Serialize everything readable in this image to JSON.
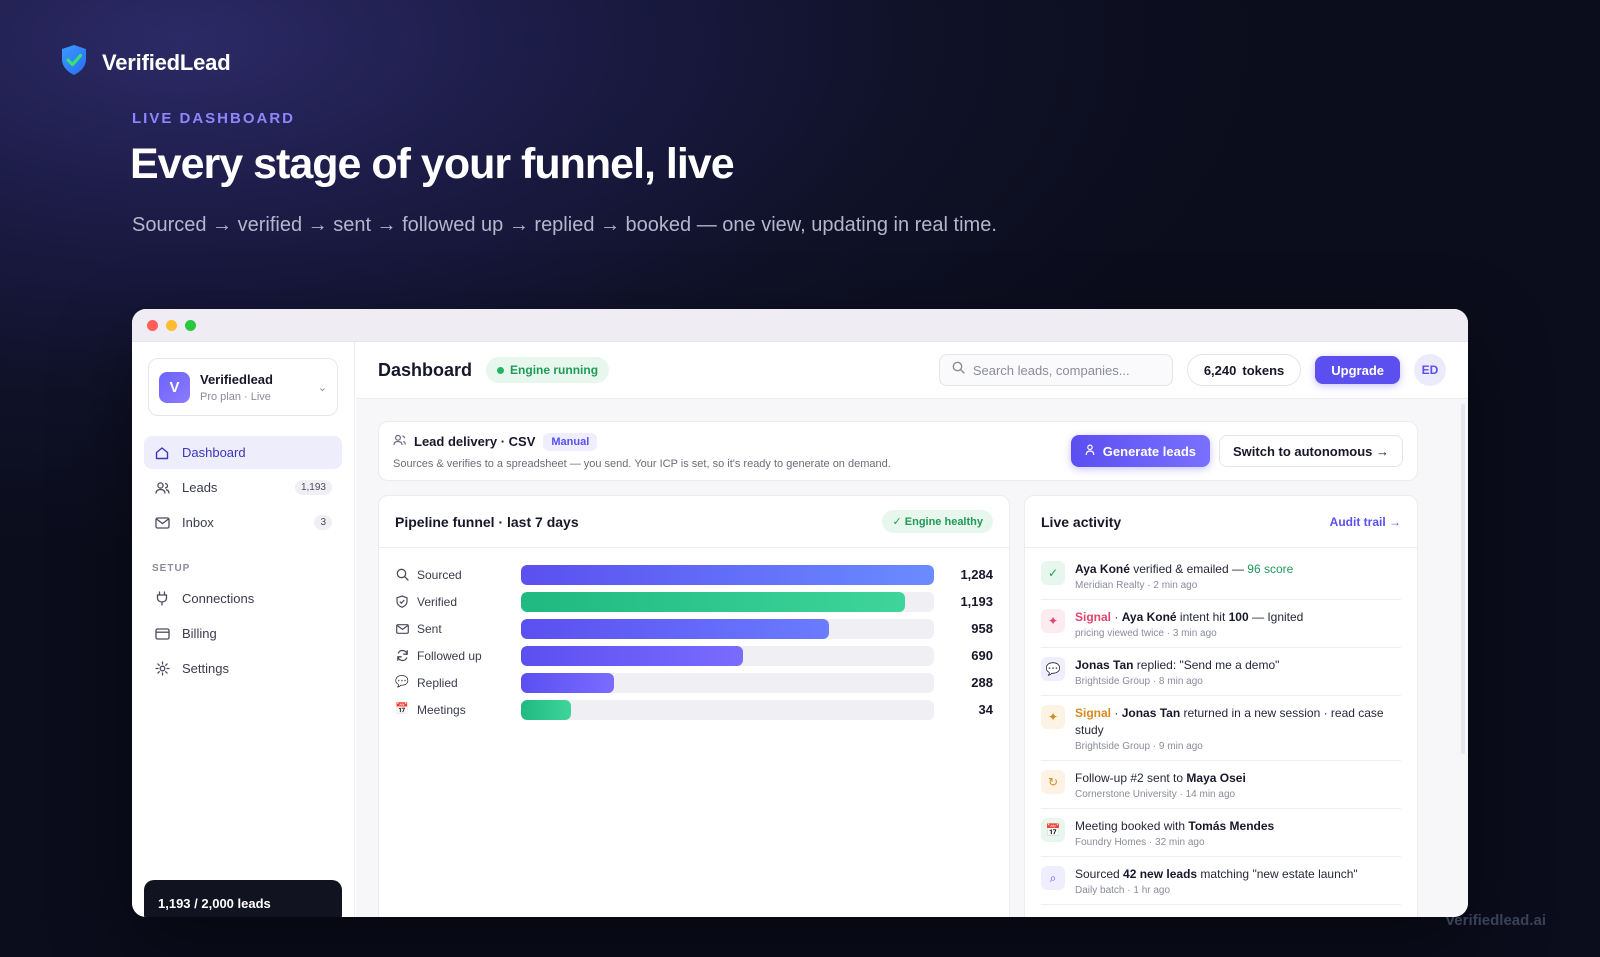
{
  "brand": {
    "name": "VerifiedLead"
  },
  "hero": {
    "eyebrow": "LIVE DASHBOARD",
    "headline": "Every stage of your funnel, live",
    "subline": "Sourced → verified → sent → followed up → replied → booked — one view, updating in real time."
  },
  "footer": {
    "url": "verifiedlead.ai"
  },
  "sidebar": {
    "workspace": {
      "initial": "V",
      "name": "Verifiedlead",
      "plan": "Pro plan · Live"
    },
    "items": [
      {
        "label": "Dashboard",
        "icon": "home-icon",
        "active": true
      },
      {
        "label": "Leads",
        "icon": "users-icon",
        "count": "1,193"
      },
      {
        "label": "Inbox",
        "icon": "mail-icon",
        "count": "3"
      }
    ],
    "setup_label": "SETUP",
    "setup_items": [
      {
        "label": "Connections",
        "icon": "plug-icon"
      },
      {
        "label": "Billing",
        "icon": "card-icon"
      },
      {
        "label": "Settings",
        "icon": "gear-icon"
      }
    ],
    "quota": "1,193 / 2,000 leads"
  },
  "topbar": {
    "title": "Dashboard",
    "status": "Engine running",
    "search_placeholder": "Search leads, companies...",
    "tokens_value": "6,240",
    "tokens_label": "tokens",
    "upgrade": "Upgrade",
    "avatar": "ED"
  },
  "delivery": {
    "title": "Lead delivery · CSV",
    "badge": "Manual",
    "desc": "Sources & verifies to a spreadsheet — you send. Your ICP is set, so it's ready to generate on demand.",
    "generate": "Generate leads",
    "autonomous": "Switch to autonomous →"
  },
  "funnel": {
    "title": "Pipeline funnel · last 7 days",
    "badge": "✓ Engine healthy",
    "rows": [
      {
        "label": "Sourced",
        "value": "1,284",
        "fraction": 1.0,
        "color": "#5b4ff0",
        "color2": "#6a8cff",
        "icon": "search-icon"
      },
      {
        "label": "Verified",
        "value": "1,193",
        "fraction": 0.929,
        "color": "#1fb981",
        "color2": "#3fd59a",
        "icon": "shield-icon"
      },
      {
        "label": "Sent",
        "value": "958",
        "fraction": 0.746,
        "color": "#5b4ff0",
        "color2": "#6a7cff",
        "icon": "mail-icon"
      },
      {
        "label": "Followed up",
        "value": "690",
        "fraction": 0.537,
        "color": "#5b4ff0",
        "color2": "#7a6cff",
        "icon": "refresh-icon"
      },
      {
        "label": "Replied",
        "value": "288",
        "fraction": 0.224,
        "color": "#5b4ff0",
        "color2": "#7a6cff",
        "icon": "chat-icon"
      },
      {
        "label": "Meetings",
        "value": "34",
        "fraction": 0.12,
        "color": "#1fb981",
        "color2": "#3fd59a",
        "icon": "calendar-icon"
      }
    ]
  },
  "activity": {
    "title": "Live activity",
    "audit": "Audit trail →",
    "items": [
      {
        "icon": "check-icon",
        "glyph": "✓",
        "bg": "#e7f7ee",
        "fg": "#1f9a57",
        "parts": [
          {
            "t": "Aya Koné",
            "s": "b"
          },
          {
            "t": " verified & emailed — "
          },
          {
            "t": "96 score",
            "s": "score"
          }
        ],
        "meta": "Meridian Realty · 2 min ago"
      },
      {
        "icon": "spark-icon",
        "glyph": "✦",
        "bg": "#fdecef",
        "fg": "#e0456b",
        "parts": [
          {
            "t": "Signal",
            "s": "sig",
            "c": "#e0456b"
          },
          {
            "t": " · "
          },
          {
            "t": "Aya Koné",
            "s": "b"
          },
          {
            "t": " intent hit "
          },
          {
            "t": "100",
            "s": "b"
          },
          {
            "t": " — Ignited"
          }
        ],
        "meta": "pricing viewed twice · 3 min ago"
      },
      {
        "icon": "chat-icon",
        "glyph": "💬",
        "bg": "#efeefe",
        "fg": "#5b4ff0",
        "parts": [
          {
            "t": "Jonas Tan",
            "s": "b"
          },
          {
            "t": " replied: \"Send me a demo\""
          }
        ],
        "meta": "Brightside Group · 8 min ago"
      },
      {
        "icon": "spark-icon",
        "glyph": "✦",
        "bg": "#fdf3e4",
        "fg": "#d98a1f",
        "parts": [
          {
            "t": "Signal",
            "s": "sig",
            "c": "#d98a1f"
          },
          {
            "t": " · "
          },
          {
            "t": "Jonas Tan",
            "s": "b"
          },
          {
            "t": " returned in a new session · read case study"
          }
        ],
        "meta": "Brightside Group · 9 min ago"
      },
      {
        "icon": "refresh-icon",
        "glyph": "↻",
        "bg": "#fdf3e4",
        "fg": "#d98a1f",
        "parts": [
          {
            "t": "Follow-up #2 sent to "
          },
          {
            "t": "Maya Osei",
            "s": "b"
          }
        ],
        "meta": "Cornerstone University · 14 min ago"
      },
      {
        "icon": "calendar-icon",
        "glyph": "📅",
        "bg": "#e7f7ee",
        "fg": "#1f9a57",
        "parts": [
          {
            "t": "Meeting booked with "
          },
          {
            "t": "Tomás Mendes",
            "s": "b"
          }
        ],
        "meta": "Foundry Homes · 32 min ago"
      },
      {
        "icon": "search-icon",
        "glyph": "⌕",
        "bg": "#efeefe",
        "fg": "#5b4ff0",
        "parts": [
          {
            "t": "Sourced "
          },
          {
            "t": "42 new leads",
            "s": "b"
          },
          {
            "t": " matching \"new estate launch\""
          }
        ],
        "meta": "Daily batch · 1 hr ago"
      }
    ]
  }
}
